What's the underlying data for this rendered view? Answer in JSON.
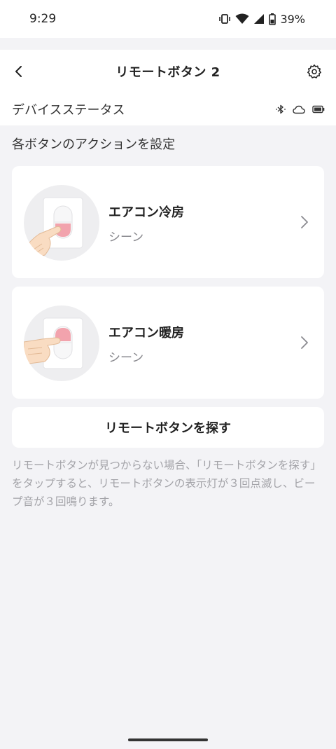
{
  "status_bar": {
    "time": "9:29",
    "battery": "39%"
  },
  "header": {
    "title": "リモートボタン 2",
    "device_status_label": "デバイスステータス"
  },
  "section_title": "各ボタンのアクションを設定",
  "actions": [
    {
      "title": "エアコン冷房",
      "subtitle": "シーン"
    },
    {
      "title": "エアコン暖房",
      "subtitle": "シーン"
    }
  ],
  "find_button_label": "リモートボタンを探す",
  "help_text": "リモートボタンが見つからない場合、「リモートボタンを探す」をタップすると、リモートボタンの表示灯が３回点滅し、ビープ音が３回鳴ります。",
  "icons": {
    "back": "back-icon",
    "settings": "gear-icon",
    "bluetooth": "bluetooth-icon",
    "cloud": "cloud-icon",
    "battery": "battery-icon",
    "chevron": "chevron-right-icon"
  },
  "colors": {
    "background": "#f3f3f6",
    "card": "#ffffff",
    "button_pink": "#f2a3ad",
    "muted_text": "#a3a3a8"
  }
}
